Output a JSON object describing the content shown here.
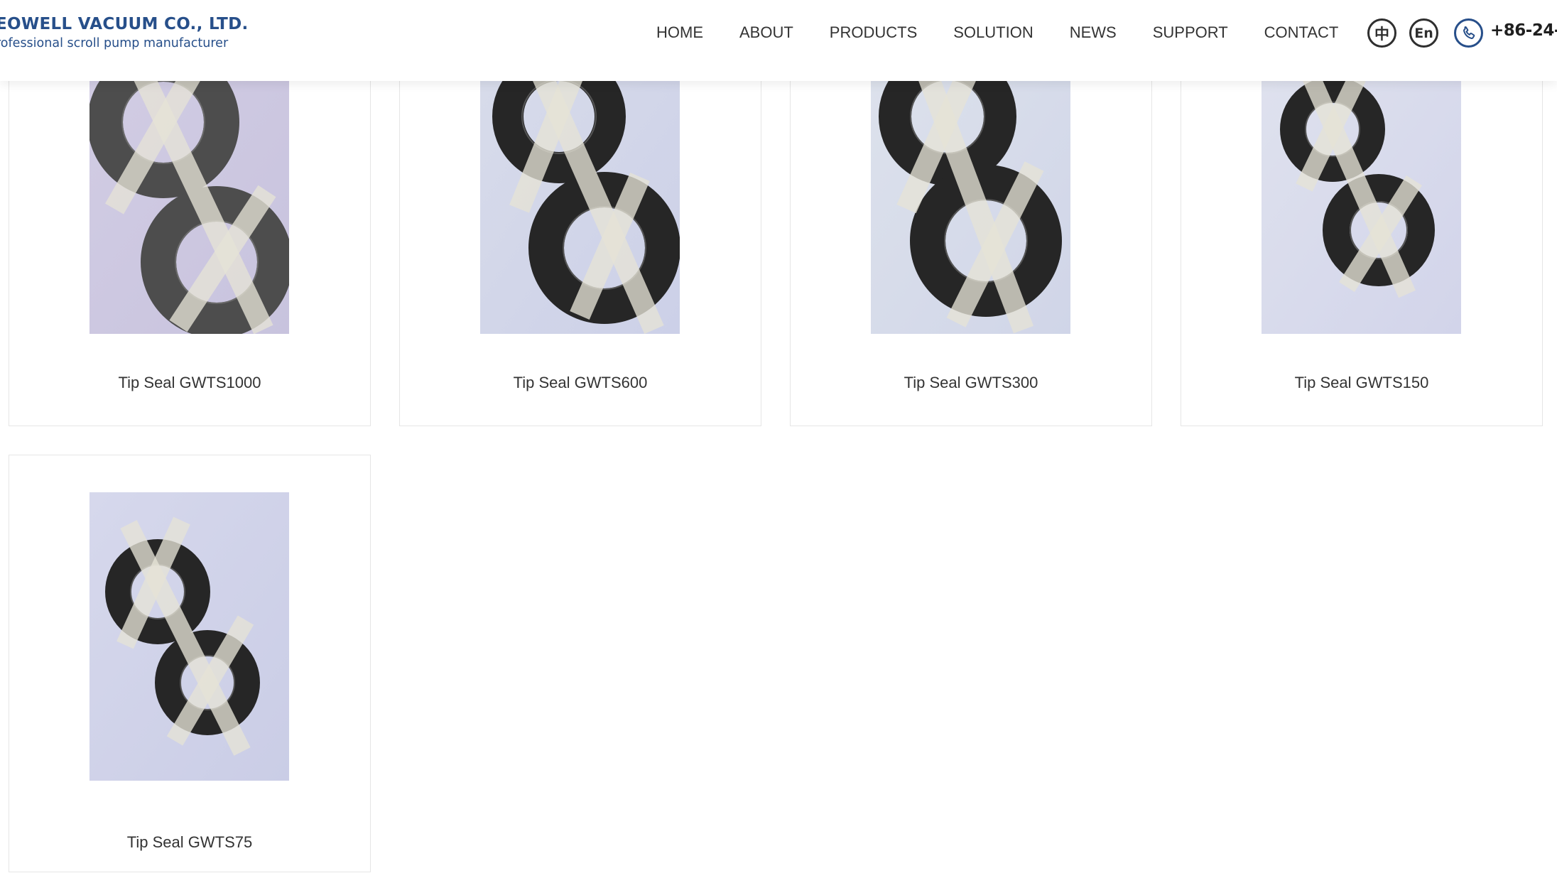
{
  "header": {
    "logo_title": "EOWELL VACUUM CO., LTD.",
    "logo_tagline": "rofessional scroll pump manufacturer",
    "nav": [
      "HOME",
      "ABOUT",
      "PRODUCTS",
      "SOLUTION",
      "NEWS",
      "SUPPORT",
      "CONTACT"
    ],
    "lang_zh": "中",
    "lang_en": "En",
    "phone": "+86-24-8",
    "brand_color": "#274f8a"
  },
  "products": [
    {
      "name": "Tip Seal GWTS1000",
      "icon": "tip-seal-photo",
      "tone": "lilac",
      "ring_color": "#4d4d4d"
    },
    {
      "name": "Tip Seal GWTS600",
      "icon": "tip-seal-photo",
      "tone": "pale-blue",
      "ring_color": "#262626"
    },
    {
      "name": "Tip Seal GWTS300",
      "icon": "tip-seal-photo",
      "tone": "pale-blue",
      "ring_color": "#262626"
    },
    {
      "name": "Tip Seal GWTS150",
      "icon": "tip-seal-photo",
      "tone": "pale-blue",
      "ring_color": "#262626"
    },
    {
      "name": "Tip Seal GWTS75",
      "icon": "tip-seal-photo",
      "tone": "pale-blue",
      "ring_color": "#262626"
    }
  ]
}
